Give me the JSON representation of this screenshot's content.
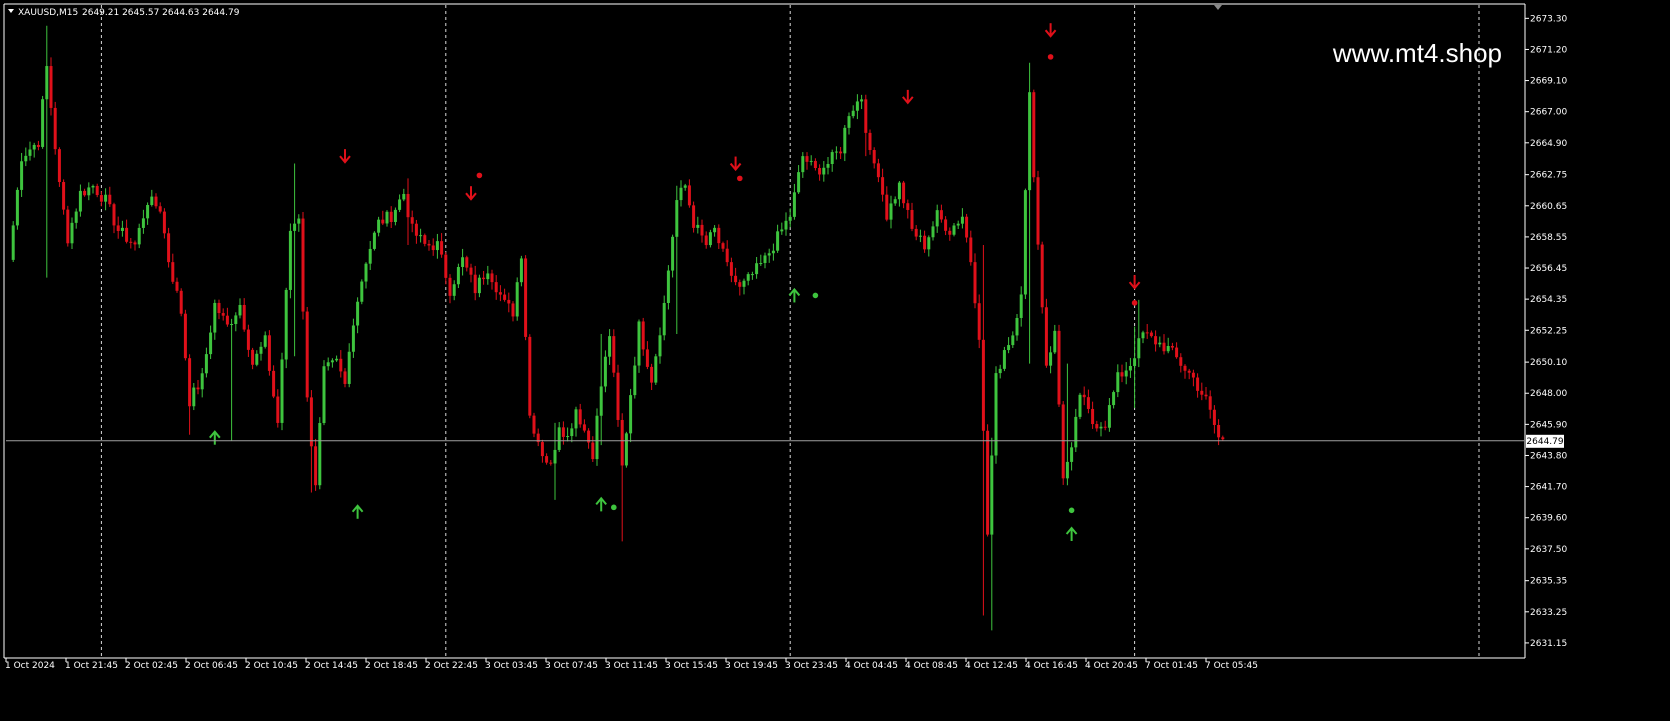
{
  "header": {
    "symbol": "XAUUSD,M15",
    "ohlc": "2649.21 2645.57 2644.63 2644.79",
    "menu_icon": "triangle-down-icon"
  },
  "watermark": "www.mt4.shop",
  "colors": {
    "background": "#000000",
    "bull": "#3ec43e",
    "bear": "#e0101a",
    "grid": "#ffffff",
    "price_line": "#a0a0a0"
  },
  "chart_data": {
    "type": "candlestick",
    "ylim": [
      2630.2,
      2674.2
    ],
    "y_ticks": [
      "2673.30",
      "2671.20",
      "2669.10",
      "2667.00",
      "2664.90",
      "2662.75",
      "2660.65",
      "2658.55",
      "2656.45",
      "2654.35",
      "2652.25",
      "2650.10",
      "2648.00",
      "2645.90",
      "2643.80",
      "2641.70",
      "2639.60",
      "2637.50",
      "2635.35",
      "2633.25",
      "2631.15"
    ],
    "current_price": "2644.79",
    "x_ticks": [
      "1 Oct 2024",
      "1 Oct 21:45",
      "2 Oct 02:45",
      "2 Oct 06:45",
      "2 Oct 10:45",
      "2 Oct 14:45",
      "2 Oct 18:45",
      "2 Oct 22:45",
      "3 Oct 03:45",
      "3 Oct 07:45",
      "3 Oct 11:45",
      "3 Oct 15:45",
      "3 Oct 19:45",
      "3 Oct 23:45",
      "4 Oct 04:45",
      "4 Oct 08:45",
      "4 Oct 12:45",
      "4 Oct 16:45",
      "4 Oct 20:45",
      "7 Oct 01:45",
      "7 Oct 05:45"
    ],
    "anchors": [
      [
        0,
        2657.0
      ],
      [
        3,
        2664.0
      ],
      [
        7,
        2665.0
      ],
      [
        9,
        2670.0
      ],
      [
        12,
        2662.0
      ],
      [
        14,
        2658.5
      ],
      [
        17,
        2661.5
      ],
      [
        20,
        2662.0
      ],
      [
        23,
        2661.0
      ],
      [
        26,
        2659.0
      ],
      [
        30,
        2658.0
      ],
      [
        33,
        2661.0
      ],
      [
        36,
        2660.5
      ],
      [
        38,
        2657.0
      ],
      [
        41,
        2653.5
      ],
      [
        43,
        2647.5
      ],
      [
        46,
        2649.0
      ],
      [
        49,
        2654.0
      ],
      [
        52,
        2652.5
      ],
      [
        55,
        2654.0
      ],
      [
        58,
        2650.0
      ],
      [
        61,
        2651.5
      ],
      [
        64,
        2646.0
      ],
      [
        67,
        2659.0
      ],
      [
        69,
        2660.0
      ],
      [
        71,
        2647.5
      ],
      [
        73,
        2642.0
      ],
      [
        75,
        2649.5
      ],
      [
        78,
        2650.0
      ],
      [
        80,
        2648.5
      ],
      [
        82,
        2653.0
      ],
      [
        85,
        2657.0
      ],
      [
        88,
        2659.5
      ],
      [
        91,
        2660.0
      ],
      [
        94,
        2661.5
      ],
      [
        96,
        2659.0
      ],
      [
        99,
        2658.0
      ],
      [
        102,
        2658.0
      ],
      [
        105,
        2655.0
      ],
      [
        108,
        2657.0
      ],
      [
        111,
        2655.0
      ],
      [
        114,
        2656.5
      ],
      [
        118,
        2654.0
      ],
      [
        120,
        2653.5
      ],
      [
        122,
        2657.5
      ],
      [
        124,
        2646.5
      ],
      [
        127,
        2644.0
      ],
      [
        129,
        2643.0
      ],
      [
        131,
        2646.0
      ],
      [
        133,
        2645.0
      ],
      [
        135,
        2647.0
      ],
      [
        137,
        2645.5
      ],
      [
        139,
        2644.0
      ],
      [
        141,
        2648.5
      ],
      [
        143,
        2652.0
      ],
      [
        146,
        2643.0
      ],
      [
        148,
        2648.0
      ],
      [
        150,
        2652.5
      ],
      [
        153,
        2649.0
      ],
      [
        156,
        2654.0
      ],
      [
        159,
        2661.0
      ],
      [
        161,
        2662.0
      ],
      [
        163,
        2659.5
      ],
      [
        166,
        2658.0
      ],
      [
        168,
        2659.0
      ],
      [
        171,
        2656.5
      ],
      [
        174,
        2655.0
      ],
      [
        177,
        2656.0
      ],
      [
        180,
        2657.0
      ],
      [
        183,
        2658.5
      ],
      [
        186,
        2660.0
      ],
      [
        189,
        2664.0
      ],
      [
        192,
        2663.0
      ],
      [
        195,
        2663.5
      ],
      [
        198,
        2664.5
      ],
      [
        200,
        2667.0
      ],
      [
        203,
        2668.0
      ],
      [
        205,
        2664.0
      ],
      [
        207,
        2663.0
      ],
      [
        209,
        2660.0
      ],
      [
        212,
        2662.0
      ],
      [
        215,
        2659.0
      ],
      [
        218,
        2658.0
      ],
      [
        221,
        2660.0
      ],
      [
        224,
        2659.0
      ],
      [
        227,
        2660.0
      ],
      [
        229,
        2657.0
      ],
      [
        231,
        2652.0
      ],
      [
        233,
        2638.5
      ],
      [
        235,
        2649.0
      ],
      [
        237,
        2651.0
      ],
      [
        239,
        2652.0
      ],
      [
        241,
        2655.0
      ],
      [
        243,
        2668.0
      ],
      [
        245,
        2658.0
      ],
      [
        247,
        2650.0
      ],
      [
        249,
        2652.0
      ],
      [
        251,
        2642.5
      ],
      [
        253,
        2644.0
      ],
      [
        255,
        2648.0
      ],
      [
        258,
        2646.0
      ],
      [
        261,
        2646.0
      ],
      [
        264,
        2649.0
      ],
      [
        267,
        2650.0
      ],
      [
        270,
        2652.0
      ],
      [
        273,
        2651.5
      ],
      [
        276,
        2651.0
      ],
      [
        279,
        2650.0
      ],
      [
        282,
        2649.0
      ],
      [
        285,
        2647.5
      ],
      [
        288,
        2645.0
      ],
      [
        289,
        2644.8
      ]
    ],
    "wicks": [
      [
        9,
        2672.8,
        2655.8
      ],
      [
        43,
        2647.3,
        2645.2
      ],
      [
        53,
        2646.2,
        2644.8
      ],
      [
        68,
        2663.5,
        2650.5
      ],
      [
        72,
        2646.5,
        2641.3
      ],
      [
        95,
        2662.5,
        2658.0
      ],
      [
        130,
        2646.0,
        2640.8
      ],
      [
        141,
        2652.0,
        2644.5
      ],
      [
        146,
        2646.0,
        2638.0
      ],
      [
        159,
        2662.0,
        2652.0
      ],
      [
        204,
        2668.0,
        2664.0
      ],
      [
        232,
        2658.0,
        2633.0
      ],
      [
        234,
        2645.0,
        2632.0
      ],
      [
        243,
        2670.3,
        2650.0
      ],
      [
        252,
        2650.0,
        2642.5
      ],
      [
        268,
        2652.5,
        2647.0
      ],
      [
        269,
        2654.3,
        2651.0
      ]
    ],
    "signals": [
      {
        "type": "sell",
        "x": 80,
        "price": 2664.0
      },
      {
        "type": "sell",
        "x": 110,
        "price": 2661.5
      },
      {
        "type": "sell",
        "x": 173,
        "price": 2663.5
      },
      {
        "type": "sell",
        "x": 214,
        "price": 2668.0
      },
      {
        "type": "sell",
        "x": 248,
        "price": 2672.5
      },
      {
        "type": "sell",
        "x": 268,
        "price": 2655.5
      },
      {
        "type": "buy",
        "x": 49,
        "price": 2645.0
      },
      {
        "type": "buy",
        "x": 83,
        "price": 2640.0
      },
      {
        "type": "buy",
        "x": 141,
        "price": 2640.5
      },
      {
        "type": "buy",
        "x": 187,
        "price": 2654.6
      },
      {
        "type": "buy",
        "x": 253,
        "price": 2638.5
      }
    ],
    "dots": [
      {
        "type": "sell",
        "x": 112,
        "price": 2662.7
      },
      {
        "type": "sell",
        "x": 174,
        "price": 2662.5
      },
      {
        "type": "sell",
        "x": 248,
        "price": 2670.7
      },
      {
        "type": "sell",
        "x": 268,
        "price": 2654.1
      },
      {
        "type": "buy",
        "x": 144,
        "price": 2640.3
      },
      {
        "type": "buy",
        "x": 192,
        "price": 2654.6
      },
      {
        "type": "buy",
        "x": 253,
        "price": 2640.1
      }
    ]
  }
}
